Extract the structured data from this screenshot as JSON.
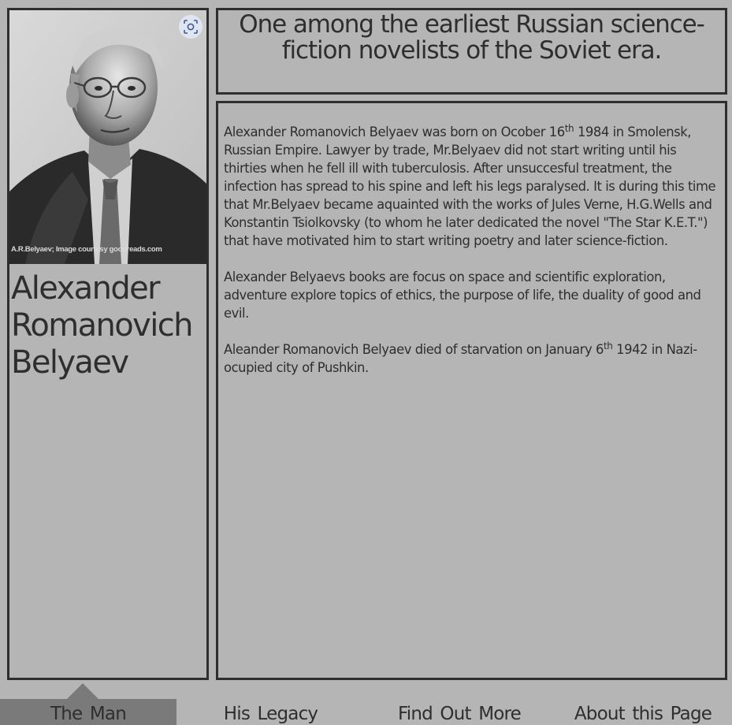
{
  "profile": {
    "photo_caption": "A.R.Belyaev; Image courtesy goodreads.com",
    "name_lines": [
      "Alexander",
      "Romanovich",
      "Belyaev"
    ]
  },
  "tagline": "One among the earliest Russian science-fiction novelists of the Soviet era.",
  "bio": {
    "p1_before_sup": "Alexander Romanovich Belyaev was born on Ocober 16",
    "p1_sup": "th",
    "p1_after_sup": " 1984 in Smolensk, Russian Empire. Lawyer by trade, Mr.Belyaev did not start writing until his thirties when he fell ill with tuberculosis. After unsuccesful treatment, the infection has spread to his spine and left his legs paralysed. It is during this time that Mr.Belyaev became aquainted with the works of Jules Verne, H.G.Wells and Konstantin Tsiolkovsky (to whom he later dedicated the novel \"The Star K.E.T.\") that have motivated him to start writing poetry and later science-fiction.",
    "p2": "Alexander Belyaevs books are focus on space and scientific exploration, adventure explore topics of ethics, the purpose of life, the duality of good and evil.",
    "p3_before_sup": "Aleander Romanovich Belyaev died of starvation on January 6",
    "p3_sup": "th",
    "p3_after_sup": " 1942 in Nazi-ocupied city of Pushkin."
  },
  "nav": {
    "items": [
      {
        "label": "The Man",
        "active": true
      },
      {
        "label": "His Legacy",
        "active": false
      },
      {
        "label": "Find Out More",
        "active": false
      },
      {
        "label": "About this Page",
        "active": false
      }
    ]
  },
  "colors": {
    "background": "#b5b5b5",
    "border": "#2e2e2e",
    "active_tab": "#7a7a7a",
    "lens_button": "#e1e8f5"
  },
  "icons": {
    "lens_button": "image-search-icon"
  }
}
